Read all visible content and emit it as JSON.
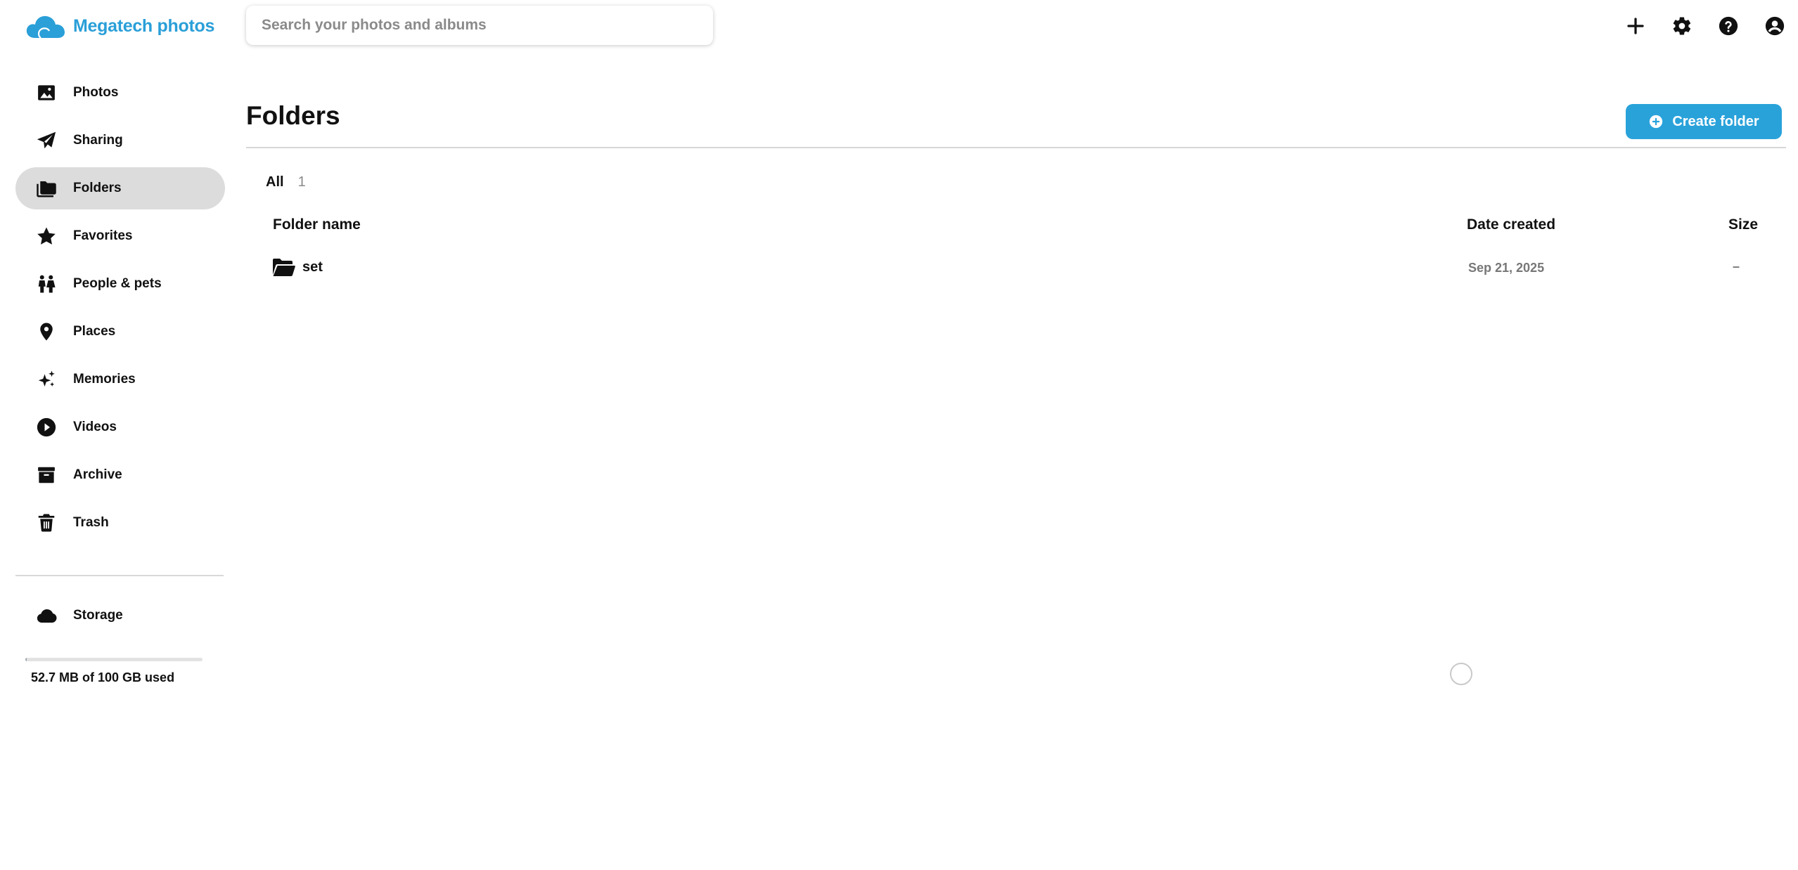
{
  "app": {
    "name": "Megatech photos",
    "brand_color": "#2a9fd8"
  },
  "search": {
    "placeholder": "Search your photos and albums",
    "value": ""
  },
  "top_actions": [
    {
      "icon": "plus-icon",
      "label": ""
    },
    {
      "icon": "gear-icon",
      "label": ""
    },
    {
      "icon": "help-icon",
      "label": ""
    },
    {
      "icon": "account-icon",
      "label": ""
    }
  ],
  "sidebar": {
    "items": [
      {
        "icon": "photo-icon",
        "label": "Photos",
        "active": false
      },
      {
        "icon": "send-icon",
        "label": "Sharing",
        "active": false
      },
      {
        "icon": "folders-icon",
        "label": "Folders",
        "active": true
      },
      {
        "icon": "star-icon",
        "label": "Favorites",
        "active": false
      },
      {
        "icon": "people-icon",
        "label": "People & pets",
        "active": false
      },
      {
        "icon": "location-pin-icon",
        "label": "Places",
        "active": false
      },
      {
        "icon": "sparkle-icon",
        "label": "Memories",
        "active": false
      },
      {
        "icon": "play-circle-icon",
        "label": "Videos",
        "active": false
      },
      {
        "icon": "archive-icon",
        "label": "Archive",
        "active": false
      },
      {
        "icon": "trash-icon",
        "label": "Trash",
        "active": false
      }
    ],
    "storage": {
      "icon": "cloud-icon",
      "label": "Storage",
      "usage_text": "52.7 MB of 100 GB used",
      "used_fraction": 0.000527
    }
  },
  "main": {
    "title": "Folders",
    "create_button": {
      "label": "Create folder",
      "icon": "plus-circle-icon",
      "color": "#29a2da"
    },
    "filter": {
      "label": "All",
      "count": "1"
    },
    "table": {
      "columns": {
        "name": "Folder name",
        "date": "Date created",
        "size": "Size"
      },
      "rows": [
        {
          "icon": "folder-open-icon",
          "name": "set",
          "date": "Sep 21, 2025",
          "size": "–"
        }
      ]
    }
  }
}
